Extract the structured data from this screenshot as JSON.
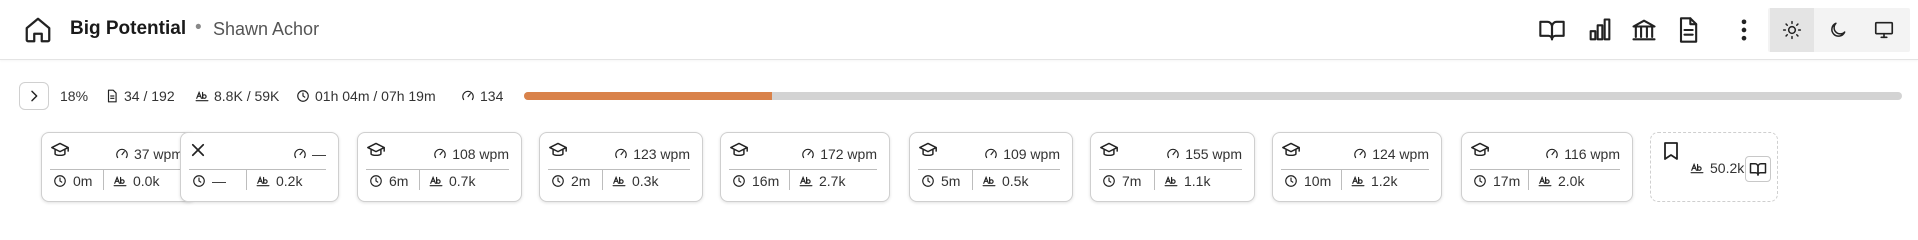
{
  "header": {
    "title": "Big Potential",
    "separator": "•",
    "author": "Shawn Achor",
    "icons": [
      "home-icon",
      "book-open-icon",
      "bar-chart-icon",
      "library-icon",
      "document-icon",
      "more-vertical-icon"
    ],
    "theme_options": [
      {
        "icon": "sun-icon",
        "active": true
      },
      {
        "icon": "moon-icon",
        "active": false
      },
      {
        "icon": "monitor-icon",
        "active": false
      }
    ]
  },
  "progress": {
    "percent_label": "18%",
    "percent_value": 0.18,
    "pages": "34 / 192",
    "words": "8.8K / 59K",
    "time": "01h 04m / 07h 19m",
    "speed": "134",
    "accent_color": "#d9824a"
  },
  "chapters": [
    {
      "status_icon": "graduation-cap-icon",
      "wpm": "37 wpm",
      "time": "0m",
      "words": "0.0k"
    },
    {
      "status_icon": "close-icon",
      "wpm": "—",
      "time": "—",
      "words": "0.2k"
    },
    {
      "status_icon": "graduation-cap-icon",
      "wpm": "108 wpm",
      "time": "6m",
      "words": "0.7k"
    },
    {
      "status_icon": "graduation-cap-icon",
      "wpm": "123 wpm",
      "time": "2m",
      "words": "0.3k"
    },
    {
      "status_icon": "graduation-cap-icon",
      "wpm": "172 wpm",
      "time": "16m",
      "words": "2.7k"
    },
    {
      "status_icon": "graduation-cap-icon",
      "wpm": "109 wpm",
      "time": "5m",
      "words": "0.5k"
    },
    {
      "status_icon": "graduation-cap-icon",
      "wpm": "155 wpm",
      "time": "7m",
      "words": "1.1k"
    },
    {
      "status_icon": "graduation-cap-icon",
      "wpm": "124 wpm",
      "time": "10m",
      "words": "1.2k"
    },
    {
      "status_icon": "graduation-cap-icon",
      "wpm": "116 wpm",
      "time": "17m",
      "words": "2.0k"
    }
  ],
  "bookmark_card": {
    "icon": "bookmark-icon",
    "words": "50.2k",
    "open_icon": "book-open-icon"
  }
}
